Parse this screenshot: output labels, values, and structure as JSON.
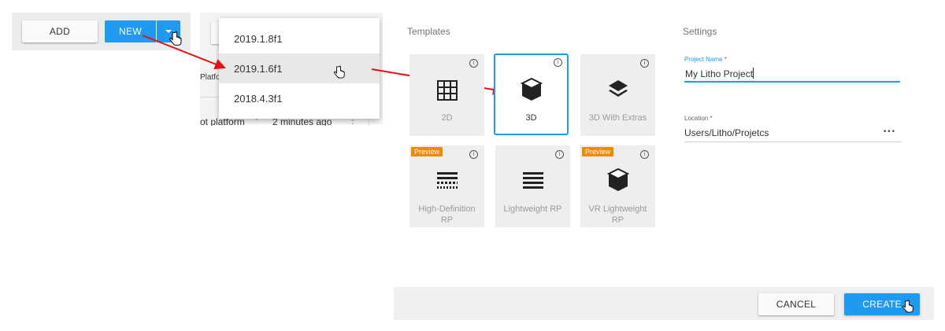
{
  "toolbar": {
    "add_label": "ADD",
    "new_label": "NEW"
  },
  "background_list": {
    "platform_header": "Platfo",
    "row_platform": "ot platform",
    "row_time": "2 minutes ago"
  },
  "version_dropdown": {
    "items": [
      "2019.1.8f1",
      "2019.1.6f1",
      "2018.4.3f1"
    ],
    "hovered_index": 1
  },
  "templates": {
    "title": "Templates",
    "info_glyph": "i",
    "preview_badge": "Preview",
    "items": [
      {
        "label": "2D",
        "icon": "grid-icon",
        "selected": false,
        "preview": false
      },
      {
        "label": "3D",
        "icon": "cube-icon",
        "selected": true,
        "preview": false
      },
      {
        "label": "3D With Extras",
        "icon": "layers-icon",
        "selected": false,
        "preview": false
      },
      {
        "label": "High-Definition RP",
        "icon": "hd-render-icon",
        "selected": false,
        "preview": true
      },
      {
        "label": "Lightweight RP",
        "icon": "lines-icon",
        "selected": false,
        "preview": false
      },
      {
        "label": "VR Lightweight RP",
        "icon": "cube-icon",
        "selected": false,
        "preview": true
      }
    ]
  },
  "settings": {
    "title": "Settings",
    "project_name_label": "Project Name",
    "project_name_value": "My Litho Project",
    "location_label": "Location",
    "location_value": "Users/Litho/Projetcs",
    "required_marker": "*",
    "more_glyph": "•••"
  },
  "footer": {
    "cancel_label": "CANCEL",
    "create_label": "CREATE"
  },
  "colors": {
    "accent": "#1e9bf0",
    "arrow": "#e81010",
    "preview_badge": "#f08a00"
  }
}
